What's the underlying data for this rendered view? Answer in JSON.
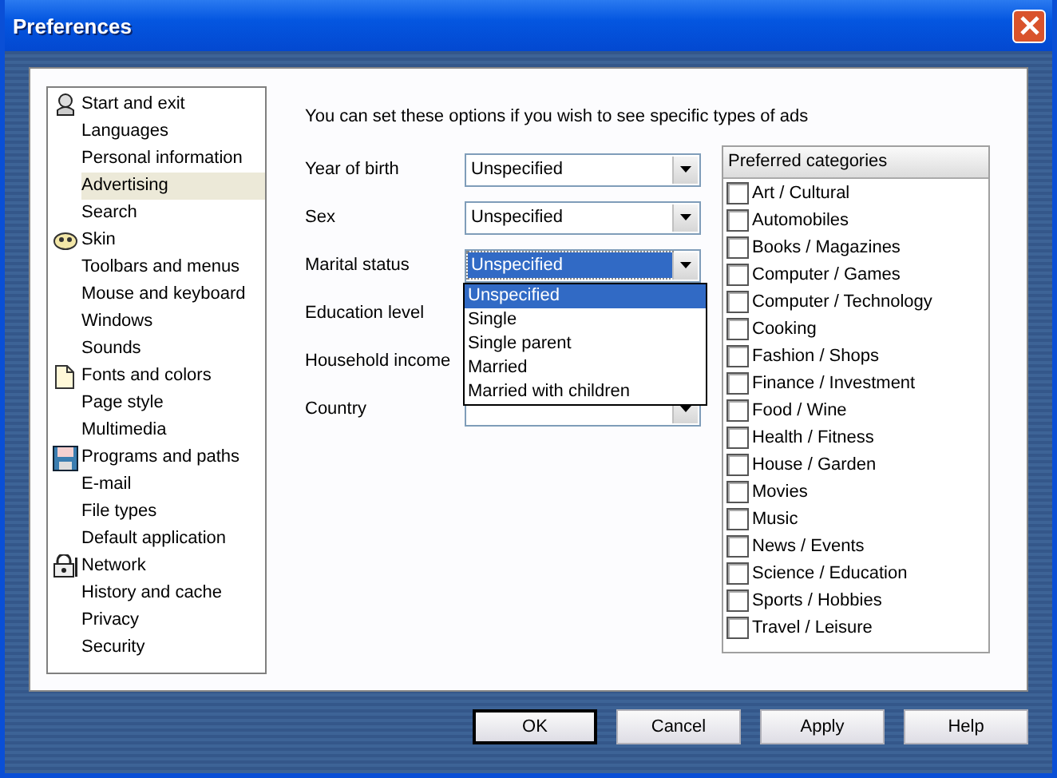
{
  "window": {
    "title": "Preferences"
  },
  "sidebar": {
    "items": [
      {
        "label": "Start and exit",
        "kind": "group",
        "selected": false
      },
      {
        "label": "Languages",
        "kind": "item",
        "selected": false
      },
      {
        "label": "Personal information",
        "kind": "item",
        "selected": false
      },
      {
        "label": "Advertising",
        "kind": "item",
        "selected": true
      },
      {
        "label": "Search",
        "kind": "item",
        "selected": false
      },
      {
        "label": "Skin",
        "kind": "group",
        "selected": false
      },
      {
        "label": "Toolbars and menus",
        "kind": "item",
        "selected": false
      },
      {
        "label": "Mouse and keyboard",
        "kind": "item",
        "selected": false
      },
      {
        "label": "Windows",
        "kind": "item",
        "selected": false
      },
      {
        "label": "Sounds",
        "kind": "item",
        "selected": false
      },
      {
        "label": "Fonts and colors",
        "kind": "group",
        "selected": false
      },
      {
        "label": "Page style",
        "kind": "item",
        "selected": false
      },
      {
        "label": "Multimedia",
        "kind": "item",
        "selected": false
      },
      {
        "label": "Programs and paths",
        "kind": "group",
        "selected": false
      },
      {
        "label": "E-mail",
        "kind": "item",
        "selected": false
      },
      {
        "label": "File types",
        "kind": "item",
        "selected": false
      },
      {
        "label": "Default application",
        "kind": "item",
        "selected": false
      },
      {
        "label": "Network",
        "kind": "group",
        "selected": false
      },
      {
        "label": "History and cache",
        "kind": "item",
        "selected": false
      },
      {
        "label": "Privacy",
        "kind": "item",
        "selected": false
      },
      {
        "label": "Security",
        "kind": "item",
        "selected": false
      }
    ]
  },
  "intro": "You can set these options if you wish to see specific types of ads",
  "fields": [
    {
      "label": "Year of birth",
      "kind": "dropdown",
      "value": "Unspecified",
      "focused": false
    },
    {
      "label": "Sex",
      "kind": "dropdown",
      "value": "Unspecified",
      "focused": false
    },
    {
      "label": "Marital status",
      "kind": "dropdown",
      "value": "Unspecified",
      "focused": true,
      "options": [
        {
          "label": "Unspecified",
          "selected": true
        },
        {
          "label": "Single",
          "selected": false
        },
        {
          "label": "Single parent",
          "selected": false
        },
        {
          "label": "Married",
          "selected": false
        },
        {
          "label": "Married with children",
          "selected": false
        }
      ]
    },
    {
      "label": "Education level",
      "kind": "covered"
    },
    {
      "label": "Household income",
      "kind": "covered"
    },
    {
      "label": "Country",
      "kind": "dropdown",
      "focused": false
    }
  ],
  "categories": {
    "title": "Preferred categories",
    "items": [
      {
        "label": "Art / Cultural",
        "checked": false
      },
      {
        "label": "Automobiles",
        "checked": false
      },
      {
        "label": "Books / Magazines",
        "checked": false
      },
      {
        "label": "Computer / Games",
        "checked": false
      },
      {
        "label": "Computer / Technology",
        "checked": false
      },
      {
        "label": "Cooking",
        "checked": false
      },
      {
        "label": "Fashion / Shops",
        "checked": false
      },
      {
        "label": "Finance / Investment",
        "checked": false
      },
      {
        "label": "Food / Wine",
        "checked": false
      },
      {
        "label": "Health / Fitness",
        "checked": false
      },
      {
        "label": "House / Garden",
        "checked": false
      },
      {
        "label": "Movies",
        "checked": false
      },
      {
        "label": "Music",
        "checked": false
      },
      {
        "label": "News / Events",
        "checked": false
      },
      {
        "label": "Science / Education",
        "checked": false
      },
      {
        "label": "Sports / Hobbies",
        "checked": false
      },
      {
        "label": "Travel / Leisure",
        "checked": false
      }
    ]
  },
  "buttons": [
    {
      "label": "OK",
      "default": true
    },
    {
      "label": "Cancel",
      "default": false
    },
    {
      "label": "Apply",
      "default": false
    },
    {
      "label": "Help",
      "default": false
    }
  ]
}
